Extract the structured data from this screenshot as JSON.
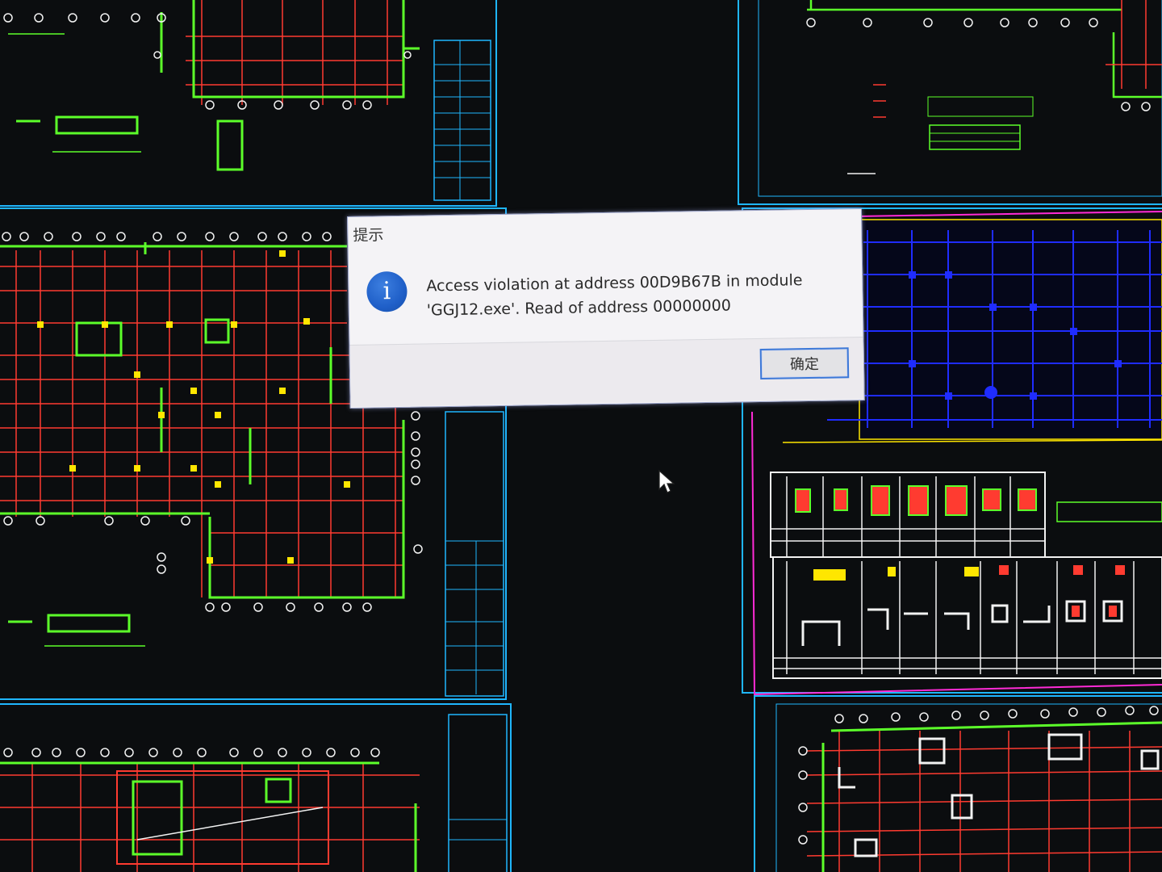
{
  "dialog": {
    "title": "提示",
    "icon": "info-icon",
    "message_line1": "Access violation at address 00D9B67B in module",
    "message_line2": "'GGJ12.exe'. Read of address 00000000",
    "ok_label": "确定"
  },
  "cad": {
    "background_color": "#0b0d0f",
    "colors": {
      "grid_red": "#ff3b30",
      "axis_green": "#5cff2a",
      "frame_cyan": "#1fb6ff",
      "detail_yellow": "#ffe600",
      "detail_blue": "#1f2cff",
      "frame_magenta": "#ff2bd6",
      "white": "#f2f2f2"
    }
  },
  "cursor": {
    "icon": "mouse-pointer-icon"
  }
}
